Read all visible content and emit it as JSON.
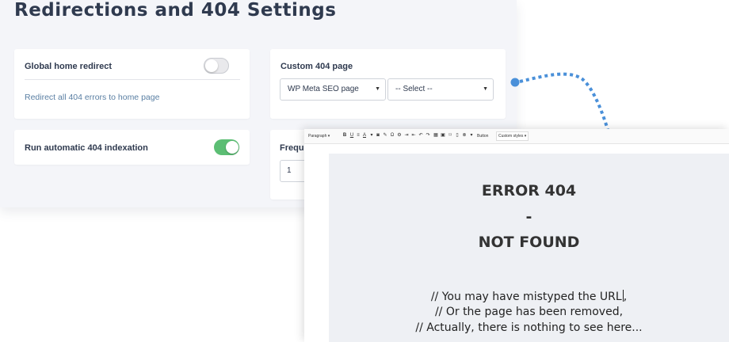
{
  "page": {
    "title": "Redirections and 404 Settings"
  },
  "global_home_redirect": {
    "label": "Global home redirect",
    "enabled": false,
    "description": "Redirect all 404 errors to home page"
  },
  "custom_404": {
    "label": "Custom 404 page",
    "page_type_select": "WP Meta SEO page",
    "page_select": "-- Select --"
  },
  "auto_indexation": {
    "label": "Run automatic 404 indexation",
    "enabled": true
  },
  "frequency": {
    "label": "Freque",
    "value": "1"
  },
  "editor": {
    "toolbar": {
      "format_select": "Paragraph",
      "button_label": "Button",
      "styles_select": "Custom styles"
    },
    "content": {
      "line1": "ERROR 404",
      "line2": "-",
      "line3": "NOT FOUND",
      "msg1": "// You may have mistyped the URL",
      "msg1_tail": ",",
      "msg2": "// Or the page has been removed,",
      "msg3": "// Actually, there is nothing to see here..."
    }
  },
  "colors": {
    "panel_bg": "#f4f5f9",
    "toggle_on": "#5cbe74",
    "arrow": "#4a90d9",
    "link": "#5a7fa3"
  }
}
